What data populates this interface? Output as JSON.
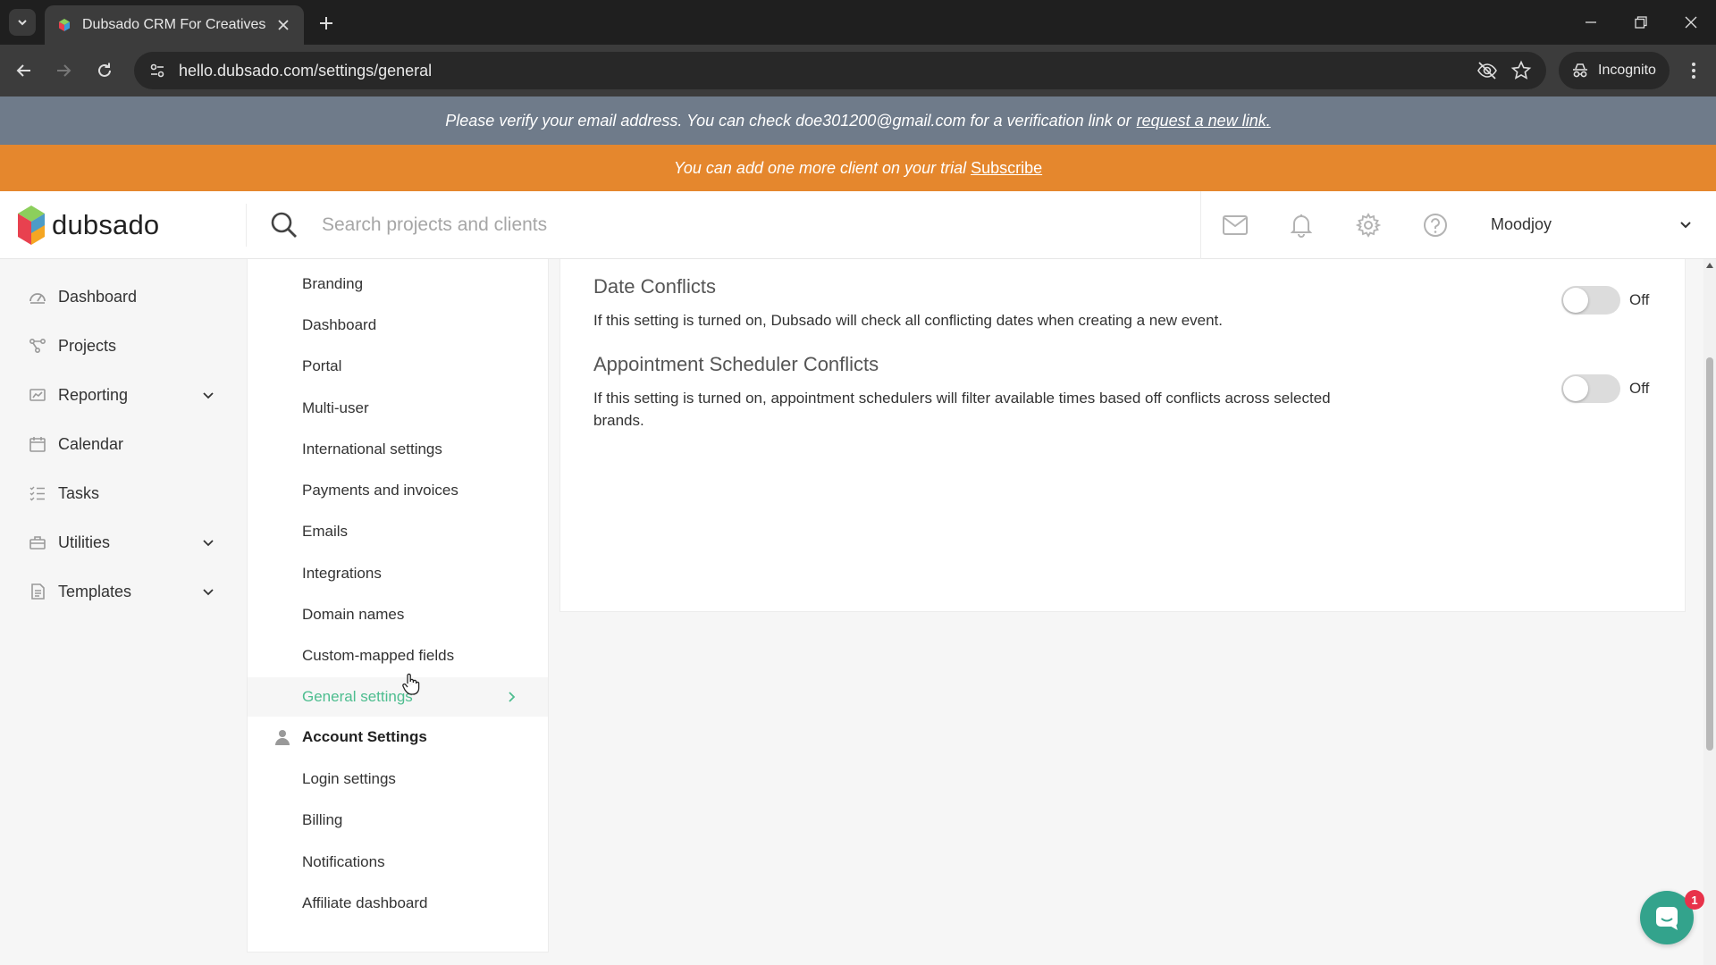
{
  "browser": {
    "tab_title": "Dubsado CRM For Creatives",
    "url": "hello.dubsado.com/settings/general",
    "incognito_label": "Incognito"
  },
  "banners": {
    "verify_text": "Please verify your email address. You can check doe301200@gmail.com for a verification link or",
    "verify_link": "request a new link.",
    "trial_text": "You can add one more client on your trial",
    "trial_link": "Subscribe"
  },
  "header": {
    "logo_text": "dubsado",
    "search_placeholder": "Search projects and clients",
    "user_name": "Moodjoy"
  },
  "sidebar": {
    "items": [
      {
        "label": "Dashboard",
        "icon": "dashboard-icon"
      },
      {
        "label": "Projects",
        "icon": "projects-icon"
      },
      {
        "label": "Reporting",
        "icon": "reporting-icon",
        "expandable": true
      },
      {
        "label": "Calendar",
        "icon": "calendar-icon"
      },
      {
        "label": "Tasks",
        "icon": "tasks-icon"
      },
      {
        "label": "Utilities",
        "icon": "utilities-icon",
        "expandable": true
      },
      {
        "label": "Templates",
        "icon": "templates-icon",
        "expandable": true
      }
    ]
  },
  "settings_nav": {
    "brand_items": [
      "Branding",
      "Dashboard",
      "Portal",
      "Multi-user",
      "International settings",
      "Payments and invoices",
      "Emails",
      "Integrations",
      "Domain names",
      "Custom-mapped fields",
      "General settings"
    ],
    "active_item": "General settings",
    "account_heading": "Account Settings",
    "account_items": [
      "Login settings",
      "Billing",
      "Notifications",
      "Affiliate dashboard"
    ]
  },
  "settings": [
    {
      "title": "Date Conflicts",
      "description": "If this setting is turned on, Dubsado will check all conflicting dates when creating a new event.",
      "state": "Off"
    },
    {
      "title": "Appointment Scheduler Conflicts",
      "description": "If this setting is turned on, appointment schedulers will filter available times based off conflicts across selected brands.",
      "state": "Off"
    }
  ],
  "chat": {
    "badge_count": "1"
  },
  "colors": {
    "accent_green": "#4dbd8f",
    "verify_banner": "#6f7b8a",
    "trial_banner": "#e5872d",
    "chat": "#33a38c"
  }
}
